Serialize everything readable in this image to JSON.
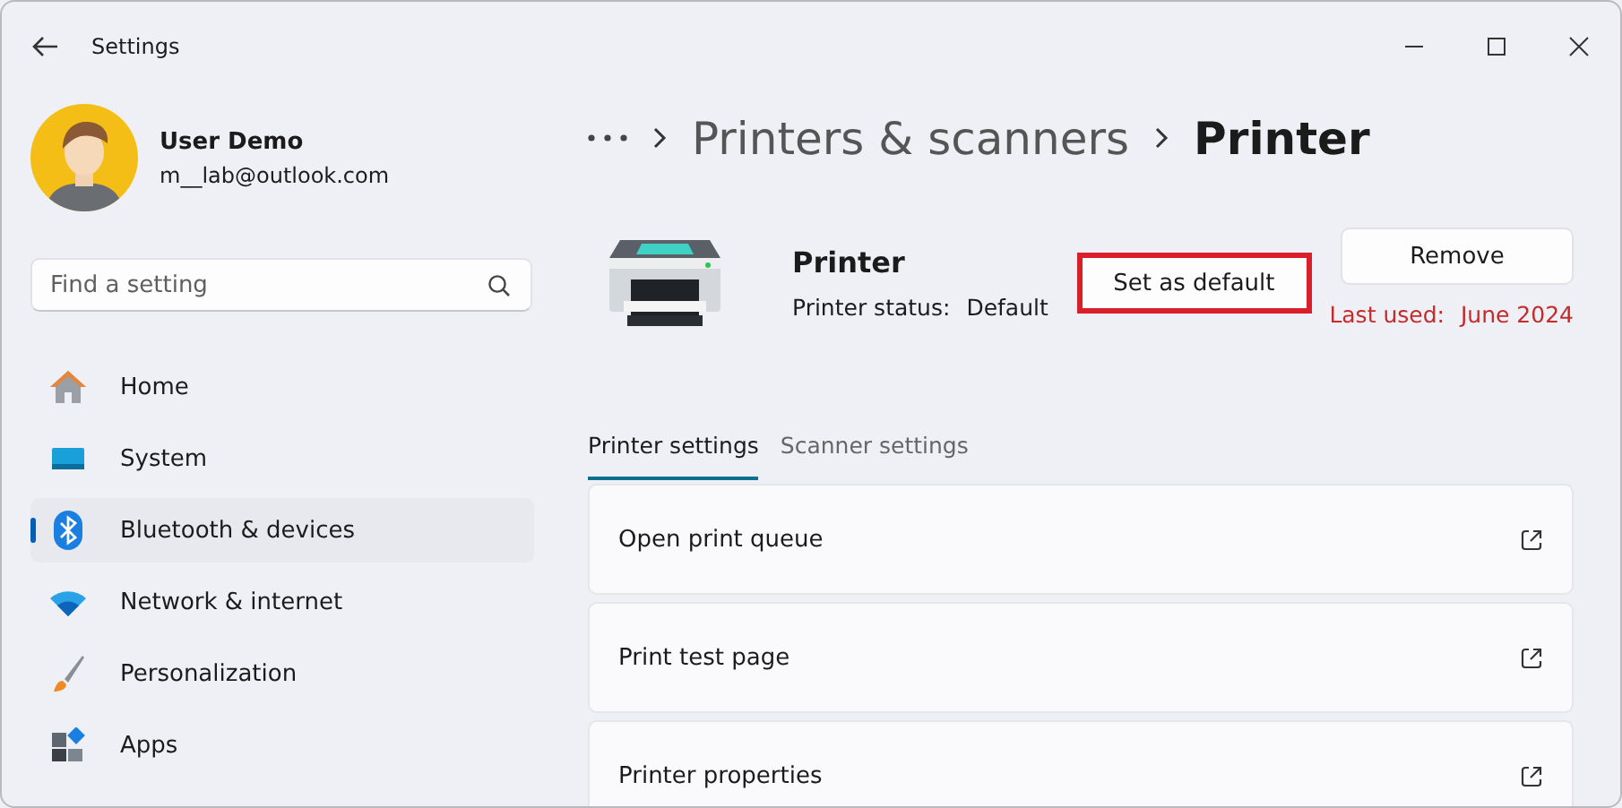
{
  "window": {
    "title": "Settings"
  },
  "user": {
    "name": "User Demo",
    "email": "m__lab@outlook.com"
  },
  "search": {
    "placeholder": "Find a setting"
  },
  "sidebar": {
    "items": [
      {
        "label": "Home",
        "kind": "home",
        "selected": false
      },
      {
        "label": "System",
        "kind": "system",
        "selected": false
      },
      {
        "label": "Bluetooth & devices",
        "kind": "bluetooth",
        "selected": true
      },
      {
        "label": "Network & internet",
        "kind": "network",
        "selected": false
      },
      {
        "label": "Personalization",
        "kind": "brush",
        "selected": false
      },
      {
        "label": "Apps",
        "kind": "apps",
        "selected": false
      }
    ]
  },
  "breadcrumb": {
    "items": [
      "Printers & scanners",
      "Printer"
    ]
  },
  "device": {
    "name": "Printer",
    "status_label": "Printer status:",
    "status_value": "Default"
  },
  "actions": {
    "set_default": {
      "label": "Set as default",
      "highlighted": true
    },
    "remove": {
      "label": "Remove"
    },
    "last_used_label": "Last used:",
    "last_used_value": "June 2024"
  },
  "tabs": [
    {
      "label": "Printer settings",
      "selected": true
    },
    {
      "label": "Scanner settings",
      "selected": false
    }
  ],
  "cards": [
    {
      "label": "Open print queue"
    },
    {
      "label": "Print test page"
    },
    {
      "label": "Printer properties"
    }
  ]
}
